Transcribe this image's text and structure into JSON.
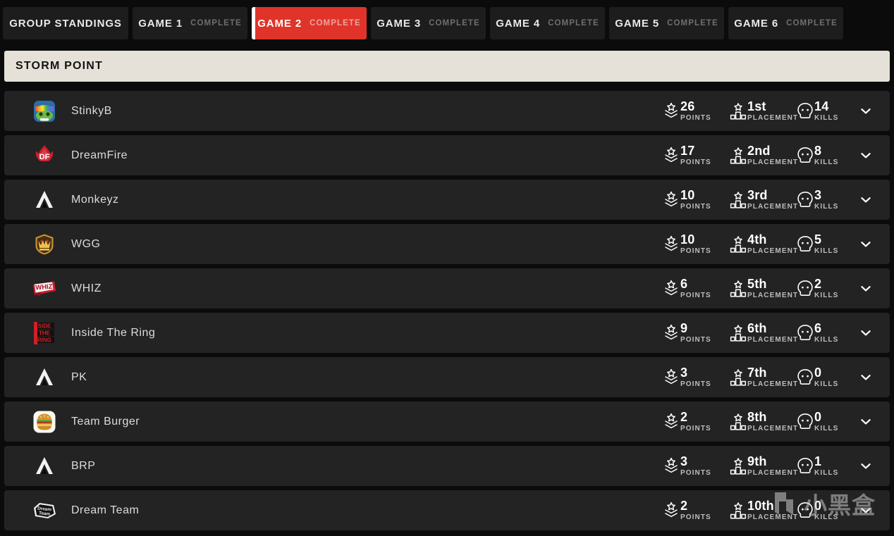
{
  "tabs": [
    {
      "label": "GROUP STANDINGS",
      "status": "",
      "active": false,
      "kind": "standings"
    },
    {
      "label": "GAME 1",
      "status": "COMPLETE",
      "active": false,
      "kind": "game"
    },
    {
      "label": "GAME 2",
      "status": "COMPLETE",
      "active": true,
      "kind": "game"
    },
    {
      "label": "GAME 3",
      "status": "COMPLETE",
      "active": false,
      "kind": "game"
    },
    {
      "label": "GAME 4",
      "status": "COMPLETE",
      "active": false,
      "kind": "game"
    },
    {
      "label": "GAME 5",
      "status": "COMPLETE",
      "active": false,
      "kind": "game"
    },
    {
      "label": "GAME 6",
      "status": "COMPLETE",
      "active": false,
      "kind": "game"
    }
  ],
  "map": {
    "name": "STORM POINT"
  },
  "stat_labels": {
    "points": "POINTS",
    "placement": "PLACEMENT",
    "kills": "KILLS"
  },
  "icons": {
    "points": "rank-chevron-icon",
    "placement": "podium-icon",
    "kills": "skull-icon",
    "expand": "chevron-down-icon"
  },
  "colors": {
    "accent_red": "#e0342a",
    "banner_cream": "#e6e1d8",
    "row_bg": "#232323",
    "page_bg": "#0b0b0b",
    "tab_bg": "#1d1d1d"
  },
  "teams": [
    {
      "name": "StinkyB",
      "points": "26",
      "placement": "1st",
      "kills": "14",
      "logo": "stinkyb-logo"
    },
    {
      "name": "DreamFire",
      "points": "17",
      "placement": "2nd",
      "kills": "8",
      "logo": "dreamfire-logo"
    },
    {
      "name": "Monkeyz",
      "points": "10",
      "placement": "3rd",
      "kills": "3",
      "logo": "apex-default-logo"
    },
    {
      "name": "WGG",
      "points": "10",
      "placement": "4th",
      "kills": "5",
      "logo": "wgg-crown-logo"
    },
    {
      "name": "WHIZ",
      "points": "6",
      "placement": "5th",
      "kills": "2",
      "logo": "whiz-logo"
    },
    {
      "name": "Inside The Ring",
      "points": "9",
      "placement": "6th",
      "kills": "6",
      "logo": "inside-the-ring-logo"
    },
    {
      "name": "PK",
      "points": "3",
      "placement": "7th",
      "kills": "0",
      "logo": "apex-default-logo"
    },
    {
      "name": "Team Burger",
      "points": "2",
      "placement": "8th",
      "kills": "0",
      "logo": "team-burger-logo"
    },
    {
      "name": "BRP",
      "points": "3",
      "placement": "9th",
      "kills": "1",
      "logo": "apex-default-logo"
    },
    {
      "name": "Dream Team",
      "points": "2",
      "placement": "10th",
      "kills": "0",
      "logo": "dream-team-logo"
    }
  ],
  "watermark": {
    "text": "小黑盒"
  }
}
